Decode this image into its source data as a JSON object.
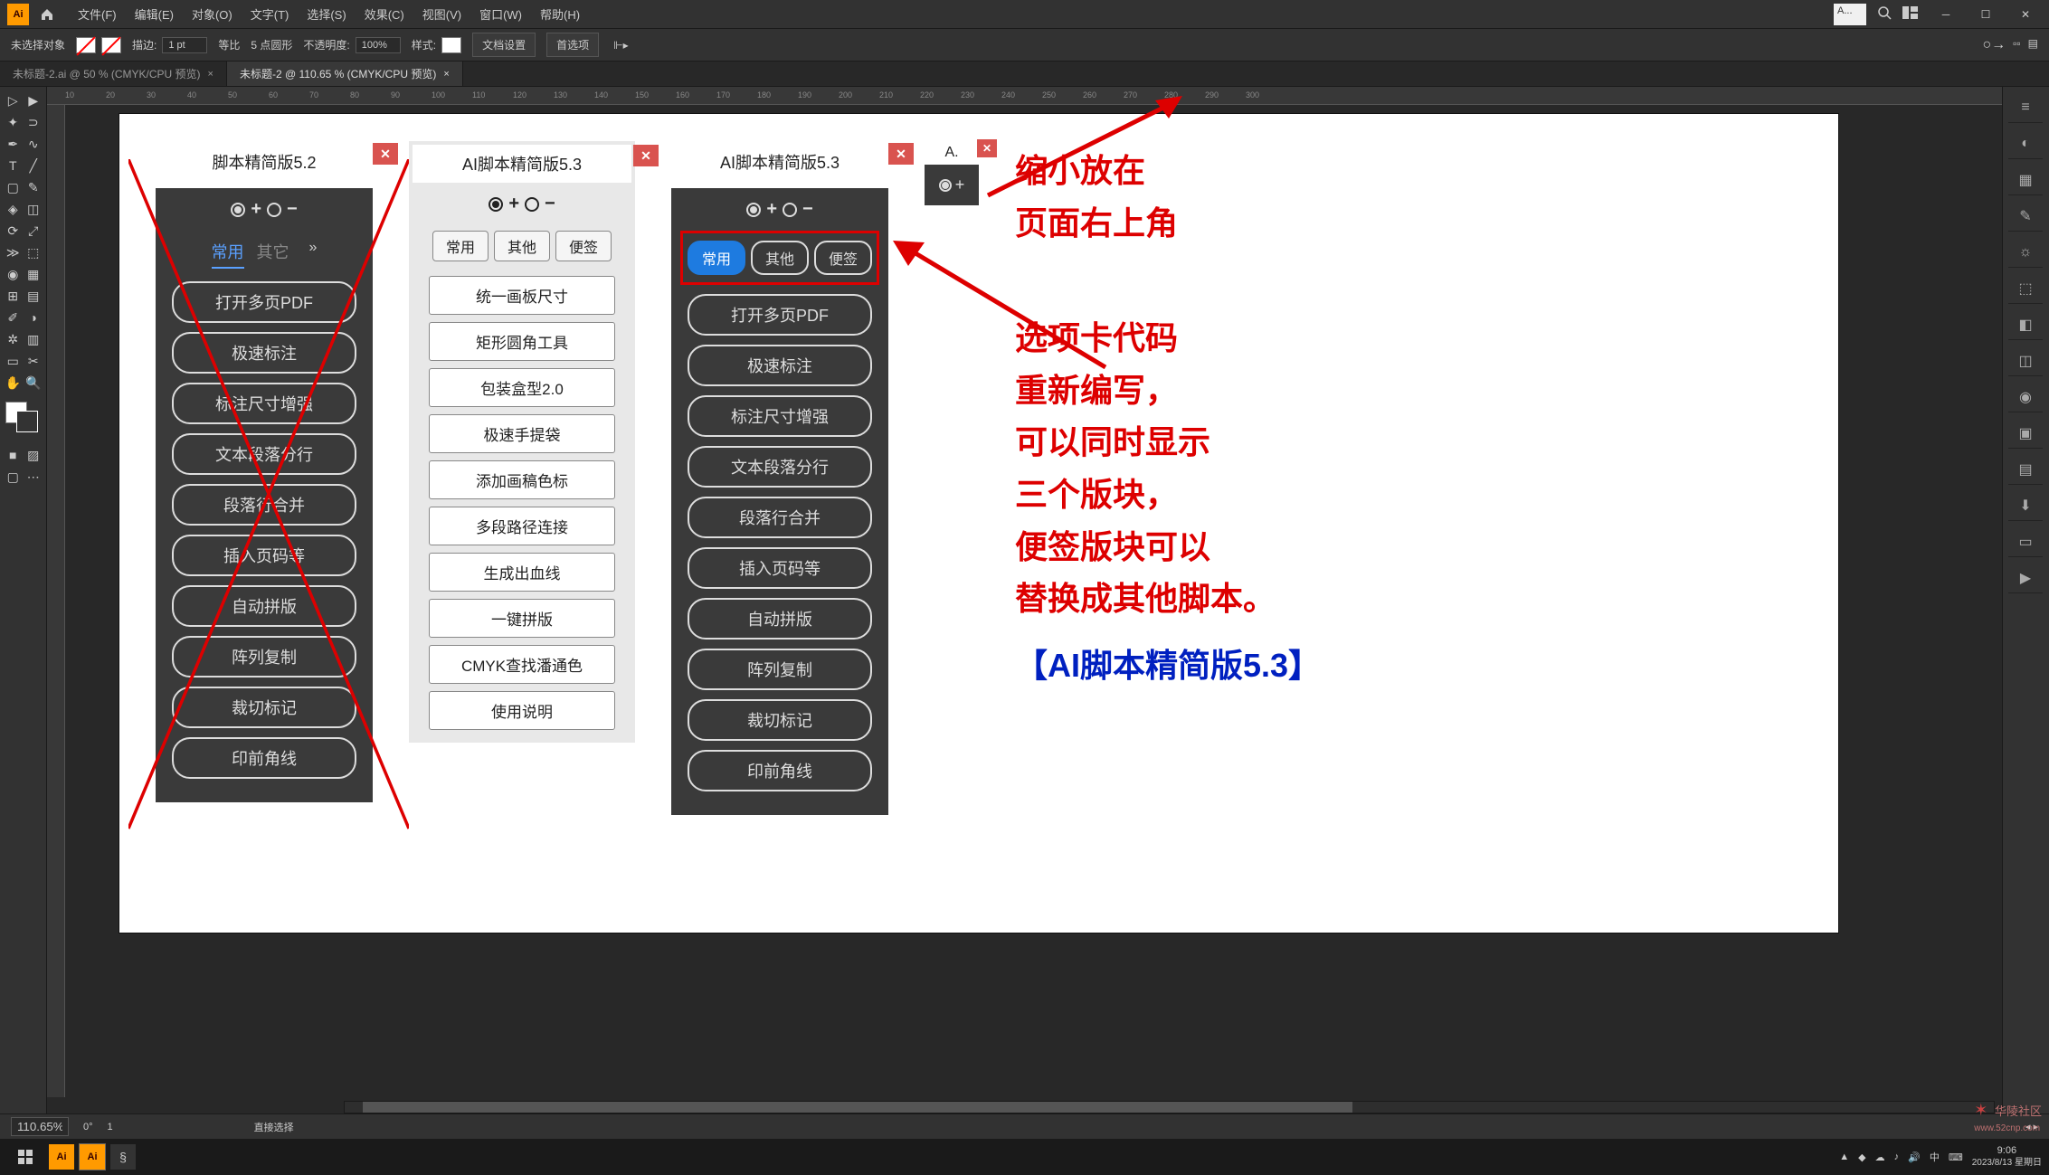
{
  "app": {
    "logo": "Ai"
  },
  "menu": {
    "items": [
      "文件(F)",
      "编辑(E)",
      "对象(O)",
      "文字(T)",
      "选择(S)",
      "效果(C)",
      "视图(V)",
      "窗口(W)",
      "帮助(H)"
    ]
  },
  "search_top": {
    "placeholder": "A..."
  },
  "controlbar": {
    "no_selection": "未选择对象",
    "stroke_label": "描边:",
    "stroke_value": "1 pt",
    "uniform": "等比",
    "round_label": "5 点圆形",
    "opacity_label": "不透明度:",
    "opacity_value": "100%",
    "style_label": "样式:",
    "doc_setup": "文档设置",
    "prefs": "首选项"
  },
  "tabs": [
    {
      "label": "未标题-2.ai @ 50 % (CMYK/CPU 预览)"
    },
    {
      "label": "未标题-2 @ 110.65 % (CMYK/CPU 预览)"
    }
  ],
  "ruler_ticks": [
    10,
    20,
    30,
    40,
    50,
    60,
    70,
    80,
    90,
    100,
    110,
    120,
    130,
    140,
    150,
    160,
    170,
    180,
    190,
    200,
    210,
    220,
    230,
    240,
    250,
    260,
    270,
    280,
    290,
    300
  ],
  "panel52": {
    "title": "脚本精简版5.2",
    "close": "✕",
    "ratio_tabs": [
      "常用",
      "其它"
    ],
    "buttons": [
      "打开多页PDF",
      "极速标注",
      "标注尺寸增强",
      "文本段落分行",
      "段落行合并",
      "插入页码等",
      "自动拼版",
      "阵列复制",
      "裁切标记",
      "印前角线"
    ]
  },
  "panel53_light": {
    "title": "AI脚本精简版5.3",
    "close": "✕",
    "tabs": [
      "常用",
      "其他",
      "便签"
    ],
    "buttons": [
      "统一画板尺寸",
      "矩形圆角工具",
      "包装盒型2.0",
      "极速手提袋",
      "添加画稿色标",
      "多段路径连接",
      "生成出血线",
      "一键拼版",
      "CMYK查找潘通色",
      "使用说明"
    ]
  },
  "panel53_dark": {
    "title": "AI脚本精简版5.3",
    "close": "✕",
    "tabs": [
      "常用",
      "其他",
      "便签"
    ],
    "buttons": [
      "打开多页PDF",
      "极速标注",
      "标注尺寸增强",
      "文本段落分行",
      "段落行合并",
      "插入页码等",
      "自动拼版",
      "阵列复制",
      "裁切标记",
      "印前角线"
    ]
  },
  "mini_panel": {
    "title": "A.",
    "close": "✕"
  },
  "annotation_top": [
    "缩小放在",
    "页面右上角"
  ],
  "annotation_main": [
    "选项卡代码",
    "重新编写，",
    "可以同时显示",
    "三个版块，",
    "便签版块可以",
    "替换成其他脚本。"
  ],
  "annotation_title": "【AI脚本精简版5.3】",
  "status": {
    "zoom": "110.65%",
    "rotate": "0°",
    "artboard": "1",
    "tool": "直接选择"
  },
  "taskbar": {
    "time": "9:06",
    "date": "2023/8/13 星期日"
  },
  "watermark": {
    "text": "华陵社区",
    "url": "www.52cnp.com"
  },
  "symbols": {
    "plus": "+",
    "minus": "−"
  }
}
